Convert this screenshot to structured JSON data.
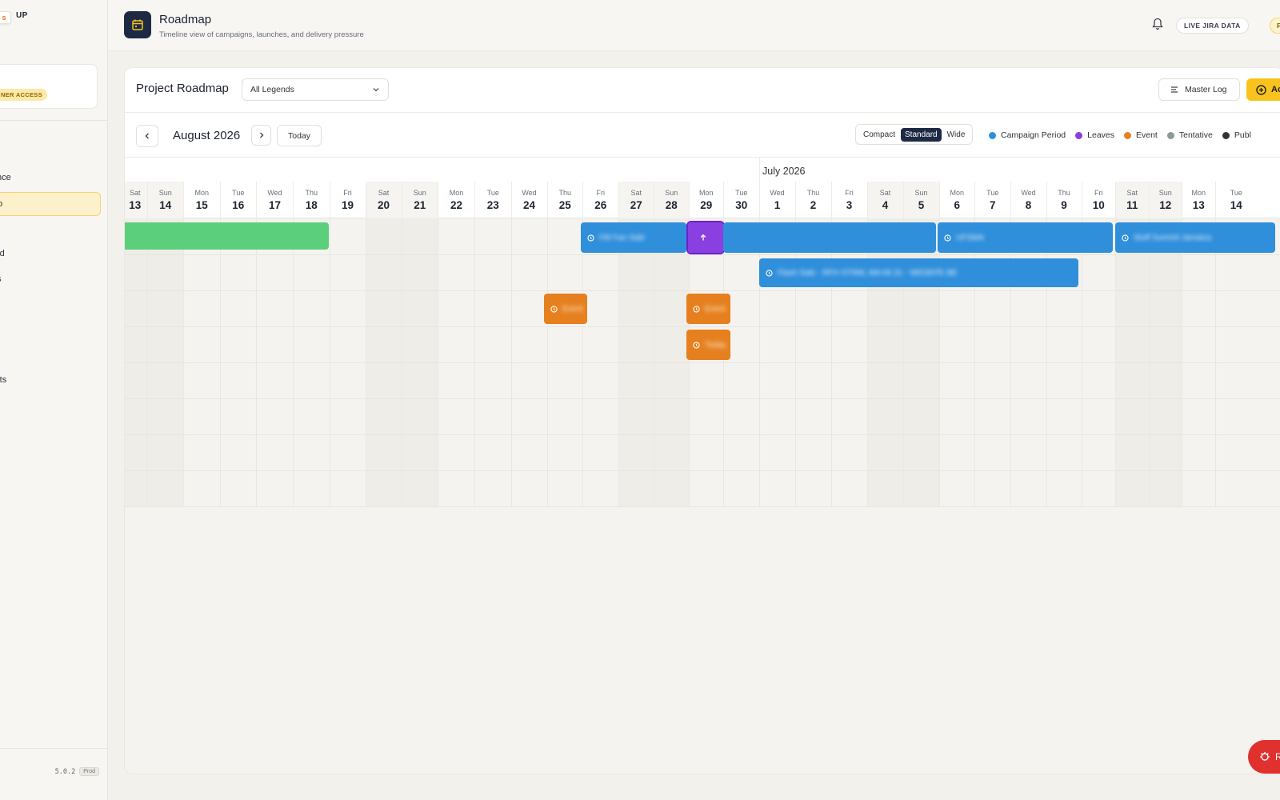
{
  "sidebar": {
    "brand_title": "UP",
    "brand_badge": "s",
    "brand_sub": "",
    "user_name": "",
    "access_badge": "NER ACCESS",
    "items": [
      {
        "label": ""
      },
      {
        "label": "nce"
      },
      {
        "label": "o",
        "active": true
      },
      {
        "label": "rd"
      },
      {
        "label": "s"
      },
      {
        "label": "rts"
      }
    ],
    "version": "5.0.2",
    "env": "Prod"
  },
  "topbar": {
    "title": "Roadmap",
    "subtitle": "Timeline view of campaigns, launches, and delivery pressure",
    "live_label": "LIVE JIRA DATA",
    "pill_label": "F",
    "icons": {
      "page": "calendar-icon",
      "bell": "bell-icon"
    }
  },
  "panel": {
    "title": "Project Roadmap",
    "legend_select": "All Legends",
    "master_log": "Master Log",
    "add_label": "Ac"
  },
  "nav": {
    "month": "August 2026",
    "today": "Today",
    "density": [
      "Compact",
      "Standard",
      "Wide"
    ],
    "density_selected": "Standard"
  },
  "legend": [
    {
      "label": "Campaign Period",
      "color": "#2f8fdb"
    },
    {
      "label": "Leaves",
      "color": "#8a3fe0"
    },
    {
      "label": "Event",
      "color": "#e6801f"
    },
    {
      "label": "Tentative",
      "color": "#8a9a94"
    },
    {
      "label": "Publ",
      "color": "#333333"
    }
  ],
  "calendar": {
    "month_label": "July 2026",
    "days": [
      {
        "dow": "Sat",
        "num": "13"
      },
      {
        "dow": "Sun",
        "num": "14"
      },
      {
        "dow": "Mon",
        "num": "15"
      },
      {
        "dow": "Tue",
        "num": "16"
      },
      {
        "dow": "Wed",
        "num": "17"
      },
      {
        "dow": "Thu",
        "num": "18"
      },
      {
        "dow": "Fri",
        "num": "19"
      },
      {
        "dow": "Sat",
        "num": "20"
      },
      {
        "dow": "Sun",
        "num": "21"
      },
      {
        "dow": "Mon",
        "num": "22"
      },
      {
        "dow": "Tue",
        "num": "23"
      },
      {
        "dow": "Wed",
        "num": "24"
      },
      {
        "dow": "Thu",
        "num": "25"
      },
      {
        "dow": "Fri",
        "num": "26"
      },
      {
        "dow": "Sat",
        "num": "27"
      },
      {
        "dow": "Sun",
        "num": "28"
      },
      {
        "dow": "Mon",
        "num": "29"
      },
      {
        "dow": "Tue",
        "num": "30"
      },
      {
        "dow": "Wed",
        "num": "1"
      },
      {
        "dow": "Thu",
        "num": "2"
      },
      {
        "dow": "Fri",
        "num": "3"
      },
      {
        "dow": "Sat",
        "num": "4"
      },
      {
        "dow": "Sun",
        "num": "5"
      },
      {
        "dow": "Mon",
        "num": "6"
      },
      {
        "dow": "Tue",
        "num": "7"
      },
      {
        "dow": "Wed",
        "num": "8"
      },
      {
        "dow": "Thu",
        "num": "9"
      },
      {
        "dow": "Fri",
        "num": "10"
      },
      {
        "dow": "Sat",
        "num": "11"
      },
      {
        "dow": "Sun",
        "num": "12"
      },
      {
        "dow": "Mon",
        "num": "13"
      },
      {
        "dow": "Tue",
        "num": "14"
      }
    ],
    "bars": [
      {
        "kind": "green",
        "label": ""
      },
      {
        "kind": "blue",
        "label": "FM Fan Sale",
        "icon": "clock-icon"
      },
      {
        "kind": "purple",
        "label": "",
        "icon": "arrow-up-icon"
      },
      {
        "kind": "blue",
        "label": "",
        "icon": ""
      },
      {
        "kind": "blue",
        "label": "UFSMA",
        "icon": "clock-icon"
      },
      {
        "kind": "blue",
        "label": "Stuff Summit Jamaica",
        "icon": "clock-icon"
      },
      {
        "kind": "blue",
        "label": "Flash Sale - RFH ST/MIL MA MI.31 - WEDEPE BE",
        "icon": "clock-icon"
      },
      {
        "kind": "orange",
        "label": "Event",
        "icon": "clock-icon"
      },
      {
        "kind": "orange",
        "label": "Event",
        "icon": "clock-icon"
      },
      {
        "kind": "orange",
        "label": "Today",
        "icon": "clock-icon"
      }
    ]
  },
  "report": {
    "label": "R",
    "icon": "bug-icon"
  }
}
